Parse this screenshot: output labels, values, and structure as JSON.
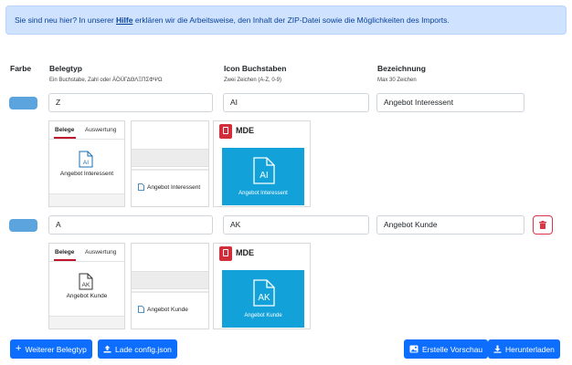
{
  "intro": {
    "before": "Sie sind neu hier? In unserer ",
    "link": "Hilfe",
    "after": " erklären wir die Arbeitsweise, den Inhalt der ZIP-Datei sowie die Möglichkeiten des Imports."
  },
  "columns": {
    "farbe": "Farbe",
    "belegtyp": "Belegtyp",
    "belegtyp_hint": "Ein Buchstabe, Zahl oder ÄÖÜΓΔΘΛΞΠΣΦΨΩ",
    "icon": "Icon Buchstaben",
    "icon_hint": "Zwei Zeichen (A-Z, 0-9)",
    "bezeichnung": "Bezeichnung",
    "bezeichnung_hint": "Max 30 Zeichen"
  },
  "rows": [
    {
      "color": "#5ba4dd",
      "belegtyp": "Z",
      "icon": "AI",
      "bezeichnung": "Angebot Interessent",
      "preview": {
        "tab_belege": "Belege",
        "tab_auswertung": "Auswertung",
        "icon_text": "AI",
        "caption": "Angebot Interessent",
        "list_item": "Angebot Interessent",
        "mde_label": "MDE",
        "tile_caption": "Angebot Interessent"
      }
    },
    {
      "color": "#5ba4dd",
      "belegtyp": "A",
      "icon": "AK",
      "bezeichnung": "Angebot Kunde",
      "preview": {
        "tab_belege": "Belege",
        "tab_auswertung": "Auswertung",
        "icon_text": "AK",
        "caption": "Angebot Kunde",
        "list_item": "Angebot Kunde",
        "mde_label": "MDE",
        "tile_caption": "Angebot Kunde"
      }
    }
  ],
  "buttons": {
    "add": "Weiterer Belegtyp",
    "load": "Lade config.json",
    "preview": "Erstelle Vorschau",
    "download": "Herunterladen"
  },
  "colors": {
    "primary": "#0d6efd",
    "danger": "#dc3545",
    "tile": "#12a1d8",
    "swatch": "#5ba4dd"
  }
}
